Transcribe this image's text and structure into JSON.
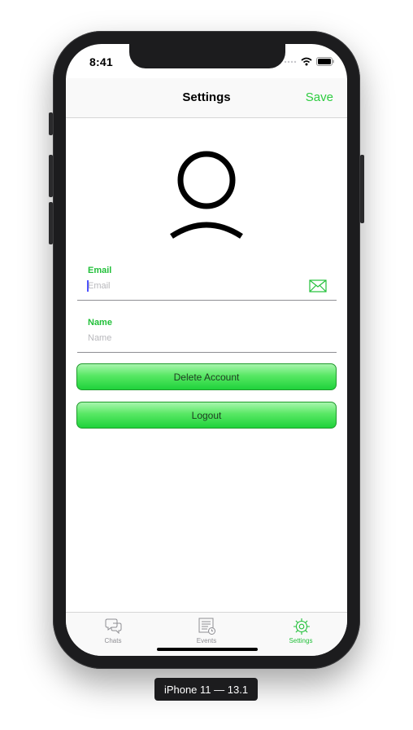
{
  "status_bar": {
    "time": "8:41"
  },
  "nav": {
    "title": "Settings",
    "save_label": "Save"
  },
  "profile": {
    "avatar_icon": "person-silhouette-icon"
  },
  "form": {
    "email": {
      "label": "Email",
      "placeholder": "Email",
      "value": "",
      "icon": "envelope-icon"
    },
    "name": {
      "label": "Name",
      "placeholder": "Name",
      "value": ""
    }
  },
  "buttons": {
    "delete_account": "Delete Account",
    "logout": "Logout"
  },
  "tabbar": {
    "items": [
      {
        "label": "Chats",
        "icon": "chat-bubbles-icon",
        "active": false
      },
      {
        "label": "Events",
        "icon": "events-list-icon",
        "active": false
      },
      {
        "label": "Settings",
        "icon": "gear-icon",
        "active": true
      }
    ]
  },
  "simulator_caption": "iPhone 11 — 13.1",
  "colors": {
    "accent": "#22c03a",
    "button_top": "#a8f5ae",
    "button_bottom": "#1fd23b"
  }
}
